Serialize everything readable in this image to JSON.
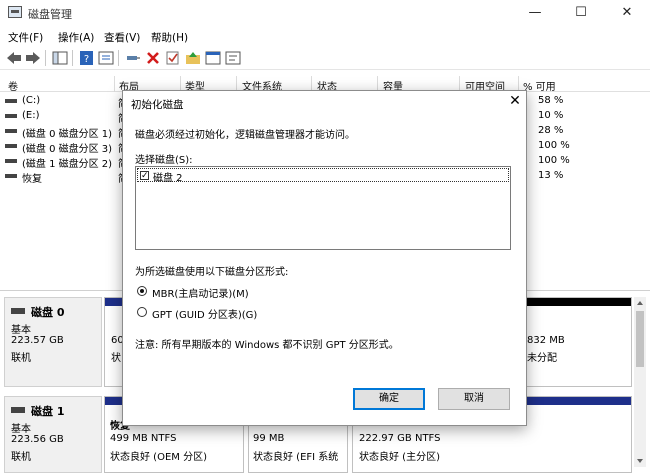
{
  "window": {
    "title": "磁盘管理",
    "minimize": "—",
    "maximize": "☐",
    "close": "✕"
  },
  "menu": [
    "文件(F)",
    "操作(A)",
    "查看(V)",
    "帮助(H)"
  ],
  "toolbar": [
    "back-icon",
    "forward-icon",
    "console-tree-icon",
    "help-icon",
    "properties-icon",
    "connect-icon",
    "delete-icon",
    "check-icon",
    "up-folder-icon",
    "new-window-icon"
  ],
  "columns": [
    "卷",
    "布局",
    "类型",
    "文件系统",
    "状态",
    "容量",
    "可用空间",
    "% 可用"
  ],
  "volumes": [
    {
      "name": "(C:)",
      "layout": "简",
      "pct": "58 %"
    },
    {
      "name": "(E:)",
      "layout": "简",
      "pct": "10 %"
    },
    {
      "name": "(磁盘 0 磁盘分区 1)",
      "layout": "简",
      "pct": "28 %"
    },
    {
      "name": "(磁盘 0 磁盘分区 3)",
      "layout": "简",
      "pct": "100 %"
    },
    {
      "name": "(磁盘 1 磁盘分区 2)",
      "layout": "简",
      "pct": "100 %"
    },
    {
      "name": "恢复",
      "layout": "简",
      "pct": "13 %"
    }
  ],
  "disks": [
    {
      "title": "磁盘 0",
      "type": "基本",
      "size": "223.57 GB",
      "status": "联机",
      "parts": [
        {
          "line1": "60",
          "line2": "状"
        },
        {
          "line1": "832 MB",
          "line2": "未分配"
        }
      ]
    },
    {
      "title": "磁盘 1",
      "type": "基本",
      "size": "223.56 GB",
      "status": "联机",
      "parts": [
        {
          "title": "恢复",
          "line1": "499 MB NTFS",
          "line2": "状态良好 (OEM 分区)"
        },
        {
          "line1": "99 MB",
          "line2": "状态良好 (EFI 系统"
        },
        {
          "line1": "222.97 GB NTFS",
          "line2": "状态良好 (主分区)"
        }
      ]
    }
  ],
  "dialog": {
    "title": "初始化磁盘",
    "close": "✕",
    "message": "磁盘必须经过初始化，逻辑磁盘管理器才能访问。",
    "select_label": "选择磁盘(S):",
    "disk_item": "磁盘 2",
    "disk_checked": "✓",
    "style_label": "为所选磁盘使用以下磁盘分区形式:",
    "mbr": "MBR(主启动记录)(M)",
    "gpt": "GPT (GUID 分区表)(G)",
    "note": "注意: 所有早期版本的 Windows 都不识别 GPT 分区形式。",
    "ok": "确定",
    "cancel": "取消"
  }
}
